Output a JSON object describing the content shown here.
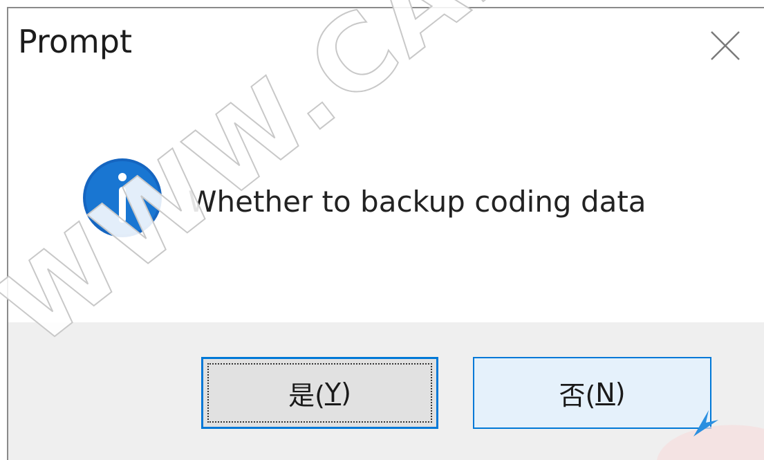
{
  "dialog": {
    "title": "Prompt",
    "message": "Whether to backup coding data",
    "icon": "info-icon",
    "buttons": {
      "yes": {
        "label": "是(",
        "accel": "Y",
        "tail": ")"
      },
      "no": {
        "label": "否(",
        "accel": "N",
        "tail": ")"
      }
    },
    "watermark": "WWW.CARDI"
  },
  "colors": {
    "accent": "#0078d7",
    "icon_blue": "#1565c0",
    "footer": "#efefef"
  }
}
